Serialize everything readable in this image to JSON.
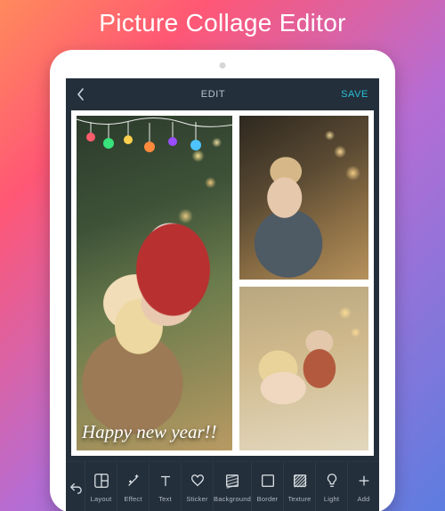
{
  "promo_title": "Picture Collage Editor",
  "header": {
    "title": "EDIT",
    "save": "SAVE"
  },
  "collage": {
    "caption": "Happy new year!!"
  },
  "tools": [
    {
      "key": "layout",
      "label": "Layout"
    },
    {
      "key": "effect",
      "label": "Effect"
    },
    {
      "key": "text",
      "label": "Text"
    },
    {
      "key": "sticker",
      "label": "Sticker"
    },
    {
      "key": "background",
      "label": "Background"
    },
    {
      "key": "border",
      "label": "Border"
    },
    {
      "key": "texture",
      "label": "Texture"
    },
    {
      "key": "light",
      "label": "Light"
    },
    {
      "key": "add",
      "label": "Add"
    }
  ],
  "colors": {
    "accent": "#29c0d8",
    "panel": "#232f3b"
  }
}
